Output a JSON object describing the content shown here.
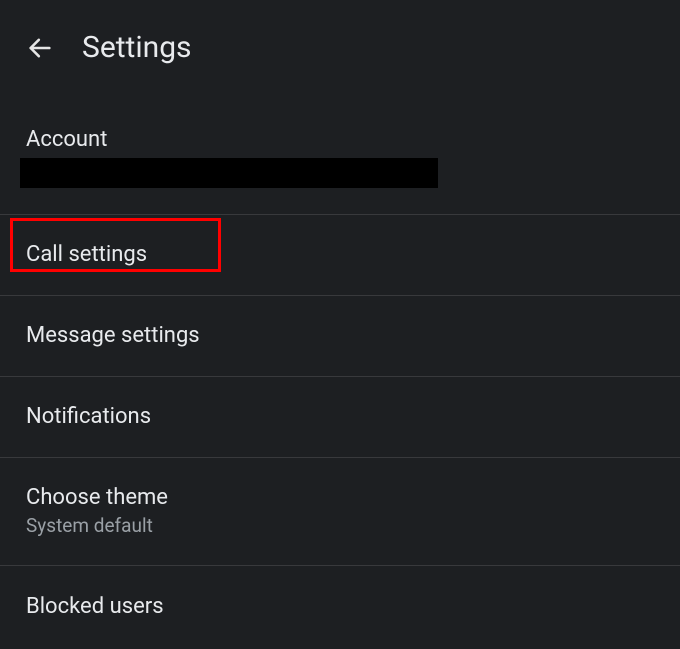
{
  "header": {
    "title": "Settings"
  },
  "account": {
    "label": "Account",
    "value": ""
  },
  "items": {
    "call": {
      "label": "Call settings"
    },
    "message": {
      "label": "Message settings"
    },
    "notifications": {
      "label": "Notifications"
    },
    "theme": {
      "label": "Choose theme",
      "sub": "System default"
    },
    "blocked": {
      "label": "Blocked users"
    }
  }
}
